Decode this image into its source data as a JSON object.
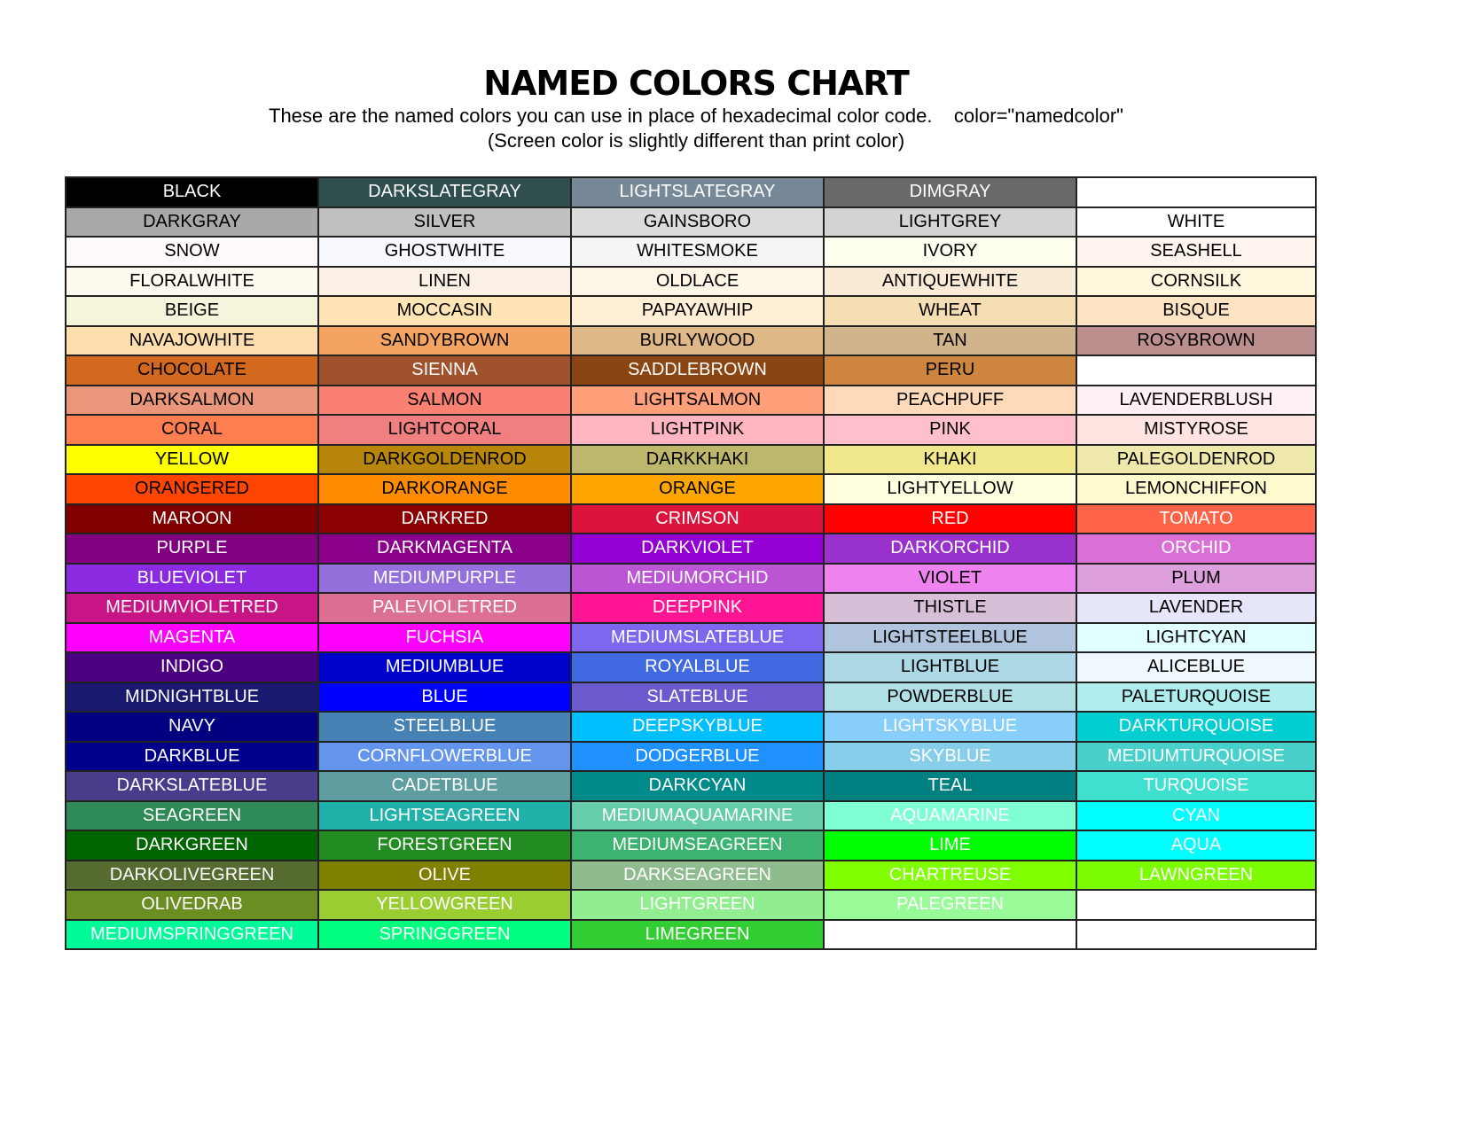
{
  "header": {
    "title": "NAMED COLORS CHART",
    "subtitle": "These are the named colors you can use in place of hexadecimal color code.    color=\"namedcolor\"",
    "note": "(Screen color is slightly different than print color)"
  },
  "rows": [
    [
      [
        "BLACK",
        "#000000",
        "#ffffff"
      ],
      [
        "DARKSLATEGRAY",
        "#2f4f4f",
        "#ffffff"
      ],
      [
        "LIGHTSLATEGRAY",
        "#778899",
        "#ffffff"
      ],
      [
        "DIMGRAY",
        "#696969",
        "#ffffff"
      ],
      [
        "",
        "#ffffff",
        "#000000"
      ]
    ],
    [
      [
        "DARKGRAY",
        "#a9a9a9",
        "#000000"
      ],
      [
        "SILVER",
        "#c0c0c0",
        "#000000"
      ],
      [
        "GAINSBORO",
        "#dcdcdc",
        "#000000"
      ],
      [
        "LIGHTGREY",
        "#d3d3d3",
        "#000000"
      ],
      [
        "WHITE",
        "#ffffff",
        "#000000"
      ]
    ],
    [
      [
        "SNOW",
        "#fffafa",
        "#000000"
      ],
      [
        "GHOSTWHITE",
        "#f8f8ff",
        "#000000"
      ],
      [
        "WHITESMOKE",
        "#f5f5f5",
        "#000000"
      ],
      [
        "IVORY",
        "#fffff0",
        "#000000"
      ],
      [
        "SEASHELL",
        "#fff5ee",
        "#000000"
      ]
    ],
    [
      [
        "FLORALWHITE",
        "#fffaf0",
        "#000000"
      ],
      [
        "LINEN",
        "#faf0e6",
        "#000000"
      ],
      [
        "OLDLACE",
        "#fdf5e6",
        "#000000"
      ],
      [
        "ANTIQUEWHITE",
        "#faebd7",
        "#000000"
      ],
      [
        "CORNSILK",
        "#fff8dc",
        "#000000"
      ]
    ],
    [
      [
        "BEIGE",
        "#f5f5dc",
        "#000000"
      ],
      [
        "MOCCASIN",
        "#ffe4b5",
        "#000000"
      ],
      [
        "PAPAYAWHIP",
        "#ffefd5",
        "#000000"
      ],
      [
        "WHEAT",
        "#f5deb3",
        "#000000"
      ],
      [
        "BISQUE",
        "#ffe4c4",
        "#000000"
      ]
    ],
    [
      [
        "NAVAJOWHITE",
        "#ffdead",
        "#000000"
      ],
      [
        "SANDYBROWN",
        "#f4a460",
        "#000000"
      ],
      [
        "BURLYWOOD",
        "#deb887",
        "#000000"
      ],
      [
        "TAN",
        "#d2b48c",
        "#000000"
      ],
      [
        "ROSYBROWN",
        "#bc8f8f",
        "#000000"
      ]
    ],
    [
      [
        "CHOCOLATE",
        "#d2691e",
        "#000000"
      ],
      [
        "SIENNA",
        "#a0522d",
        "#ffffff"
      ],
      [
        "SADDLEBROWN",
        "#8b4513",
        "#ffffff"
      ],
      [
        "PERU",
        "#cd853f",
        "#000000"
      ],
      [
        "",
        "#ffffff",
        "#000000"
      ]
    ],
    [
      [
        "DARKSALMON",
        "#e9967a",
        "#000000"
      ],
      [
        "SALMON",
        "#fa8072",
        "#000000"
      ],
      [
        "LIGHTSALMON",
        "#ffa07a",
        "#000000"
      ],
      [
        "PEACHPUFF",
        "#ffdab9",
        "#000000"
      ],
      [
        "LAVENDERBLUSH",
        "#fff0f5",
        "#000000"
      ]
    ],
    [
      [
        "CORAL",
        "#ff7f50",
        "#000000"
      ],
      [
        "LIGHTCORAL",
        "#f08080",
        "#000000"
      ],
      [
        "LIGHTPINK",
        "#ffb6c1",
        "#000000"
      ],
      [
        "PINK",
        "#ffc0cb",
        "#000000"
      ],
      [
        "MISTYROSE",
        "#ffe4e1",
        "#000000"
      ]
    ],
    [
      [
        "YELLOW",
        "#ffff00",
        "#000000"
      ],
      [
        "DARKGOLDENROD",
        "#b8860b",
        "#000000"
      ],
      [
        "DARKKHAKI",
        "#bdb76b",
        "#000000"
      ],
      [
        "KHAKI",
        "#f0e68c",
        "#000000"
      ],
      [
        "PALEGOLDENROD",
        "#eee8aa",
        "#000000"
      ]
    ],
    [
      [
        "ORANGERED",
        "#ff4500",
        "#000000"
      ],
      [
        "DARKORANGE",
        "#ff8c00",
        "#000000"
      ],
      [
        "ORANGE",
        "#ffa500",
        "#000000"
      ],
      [
        "LIGHTYELLOW",
        "#ffffe0",
        "#000000"
      ],
      [
        "LEMONCHIFFON",
        "#fffacd",
        "#000000"
      ]
    ],
    [
      [
        "MAROON",
        "#800000",
        "#ffffff"
      ],
      [
        "DARKRED",
        "#8b0000",
        "#ffffff"
      ],
      [
        "CRIMSON",
        "#dc143c",
        "#ffffff"
      ],
      [
        "RED",
        "#ff0000",
        "#ffffff"
      ],
      [
        "TOMATO",
        "#ff6347",
        "#ffffff"
      ]
    ],
    [
      [
        "PURPLE",
        "#800080",
        "#ffffff"
      ],
      [
        "DARKMAGENTA",
        "#8b008b",
        "#ffffff"
      ],
      [
        "DARKVIOLET",
        "#9400d3",
        "#ffffff"
      ],
      [
        "DARKORCHID",
        "#9932cc",
        "#ffffff"
      ],
      [
        "ORCHID",
        "#da70d6",
        "#ffffff"
      ]
    ],
    [
      [
        "BLUEVIOLET",
        "#8a2be2",
        "#ffffff"
      ],
      [
        "MEDIUMPURPLE",
        "#9370db",
        "#ffffff"
      ],
      [
        "MEDIUMORCHID",
        "#ba55d3",
        "#ffffff"
      ],
      [
        "VIOLET",
        "#ee82ee",
        "#000000"
      ],
      [
        "PLUM",
        "#dda0dd",
        "#000000"
      ]
    ],
    [
      [
        "MEDIUMVIOLETRED",
        "#c71585",
        "#ffffff"
      ],
      [
        "PALEVIOLETRED",
        "#db7093",
        "#ffffff"
      ],
      [
        "DEEPPINK",
        "#ff1493",
        "#ffffff"
      ],
      [
        "THISTLE",
        "#d8bfd8",
        "#000000"
      ],
      [
        "LAVENDER",
        "#e6e6fa",
        "#000000"
      ]
    ],
    [
      [
        "MAGENTA",
        "#ff00ff",
        "#ffffff"
      ],
      [
        "FUCHSIA",
        "#ff00ff",
        "#ffffff"
      ],
      [
        "MEDIUMSLATEBLUE",
        "#7b68ee",
        "#ffffff"
      ],
      [
        "LIGHTSTEELBLUE",
        "#b0c4de",
        "#000000"
      ],
      [
        "LIGHTCYAN",
        "#e0ffff",
        "#000000"
      ]
    ],
    [
      [
        "INDIGO",
        "#4b0082",
        "#ffffff"
      ],
      [
        "MEDIUMBLUE",
        "#0000cd",
        "#ffffff"
      ],
      [
        "ROYALBLUE",
        "#4169e1",
        "#ffffff"
      ],
      [
        "LIGHTBLUE",
        "#add8e6",
        "#000000"
      ],
      [
        "ALICEBLUE",
        "#f0f8ff",
        "#000000"
      ]
    ],
    [
      [
        "MIDNIGHTBLUE",
        "#191970",
        "#ffffff"
      ],
      [
        "BLUE",
        "#0000ff",
        "#ffffff"
      ],
      [
        "SLATEBLUE",
        "#6a5acd",
        "#ffffff"
      ],
      [
        "POWDERBLUE",
        "#b0e0e6",
        "#000000"
      ],
      [
        "PALETURQUOISE",
        "#afeeee",
        "#000000"
      ]
    ],
    [
      [
        "NAVY",
        "#000080",
        "#ffffff"
      ],
      [
        "STEELBLUE",
        "#4682b4",
        "#ffffff"
      ],
      [
        "DEEPSKYBLUE",
        "#00bfff",
        "#ffffff"
      ],
      [
        "LIGHTSKYBLUE",
        "#87cefa",
        "#ffffff"
      ],
      [
        "DARKTURQUOISE",
        "#00ced1",
        "#ffffff"
      ]
    ],
    [
      [
        "DARKBLUE",
        "#00008b",
        "#ffffff"
      ],
      [
        "CORNFLOWERBLUE",
        "#6495ed",
        "#ffffff"
      ],
      [
        "DODGERBLUE",
        "#1e90ff",
        "#ffffff"
      ],
      [
        "SKYBLUE",
        "#87ceeb",
        "#ffffff"
      ],
      [
        "MEDIUMTURQUOISE",
        "#48d1cc",
        "#ffffff"
      ]
    ],
    [
      [
        "DARKSLATEBLUE",
        "#483d8b",
        "#ffffff"
      ],
      [
        "CADETBLUE",
        "#5f9ea0",
        "#ffffff"
      ],
      [
        "DARKCYAN",
        "#008b8b",
        "#ffffff"
      ],
      [
        "TEAL",
        "#008080",
        "#ffffff"
      ],
      [
        "TURQUOISE",
        "#40e0d0",
        "#ffffff"
      ]
    ],
    [
      [
        "SEAGREEN",
        "#2e8b57",
        "#ffffff"
      ],
      [
        "LIGHTSEAGREEN",
        "#20b2aa",
        "#ffffff"
      ],
      [
        "MEDIUMAQUAMARINE",
        "#66cdaa",
        "#ffffff"
      ],
      [
        "AQUAMARINE",
        "#7fffd4",
        "#ffffff"
      ],
      [
        "CYAN",
        "#00ffff",
        "#ffffff"
      ]
    ],
    [
      [
        "DARKGREEN",
        "#006400",
        "#ffffff"
      ],
      [
        "FORESTGREEN",
        "#228b22",
        "#ffffff"
      ],
      [
        "MEDIUMSEAGREEN",
        "#3cb371",
        "#ffffff"
      ],
      [
        "LIME",
        "#00ff00",
        "#ffffff"
      ],
      [
        "AQUA",
        "#00ffff",
        "#ffffff"
      ]
    ],
    [
      [
        "DARKOLIVEGREEN",
        "#556b2f",
        "#ffffff"
      ],
      [
        "OLIVE",
        "#808000",
        "#ffffff"
      ],
      [
        "DARKSEAGREEN",
        "#8fbc8f",
        "#ffffff"
      ],
      [
        "CHARTREUSE",
        "#7fff00",
        "#ffffff"
      ],
      [
        "LAWNGREEN",
        "#7cfc00",
        "#ffffff"
      ]
    ],
    [
      [
        "OLIVEDRAB",
        "#6b8e23",
        "#ffffff"
      ],
      [
        "YELLOWGREEN",
        "#9acd32",
        "#ffffff"
      ],
      [
        "LIGHTGREEN",
        "#90ee90",
        "#ffffff"
      ],
      [
        "PALEGREEN",
        "#98fb98",
        "#ffffff"
      ],
      [
        "",
        "#ffffff",
        "#000000"
      ]
    ],
    [
      [
        "MEDIUMSPRINGGREEN",
        "#00fa9a",
        "#ffffff"
      ],
      [
        "SPRINGGREEN",
        "#00ff7f",
        "#ffffff"
      ],
      [
        "LIMEGREEN",
        "#32cd32",
        "#ffffff"
      ],
      [
        "",
        "#ffffff",
        "#000000"
      ],
      [
        "",
        "#ffffff",
        "#000000"
      ]
    ]
  ]
}
